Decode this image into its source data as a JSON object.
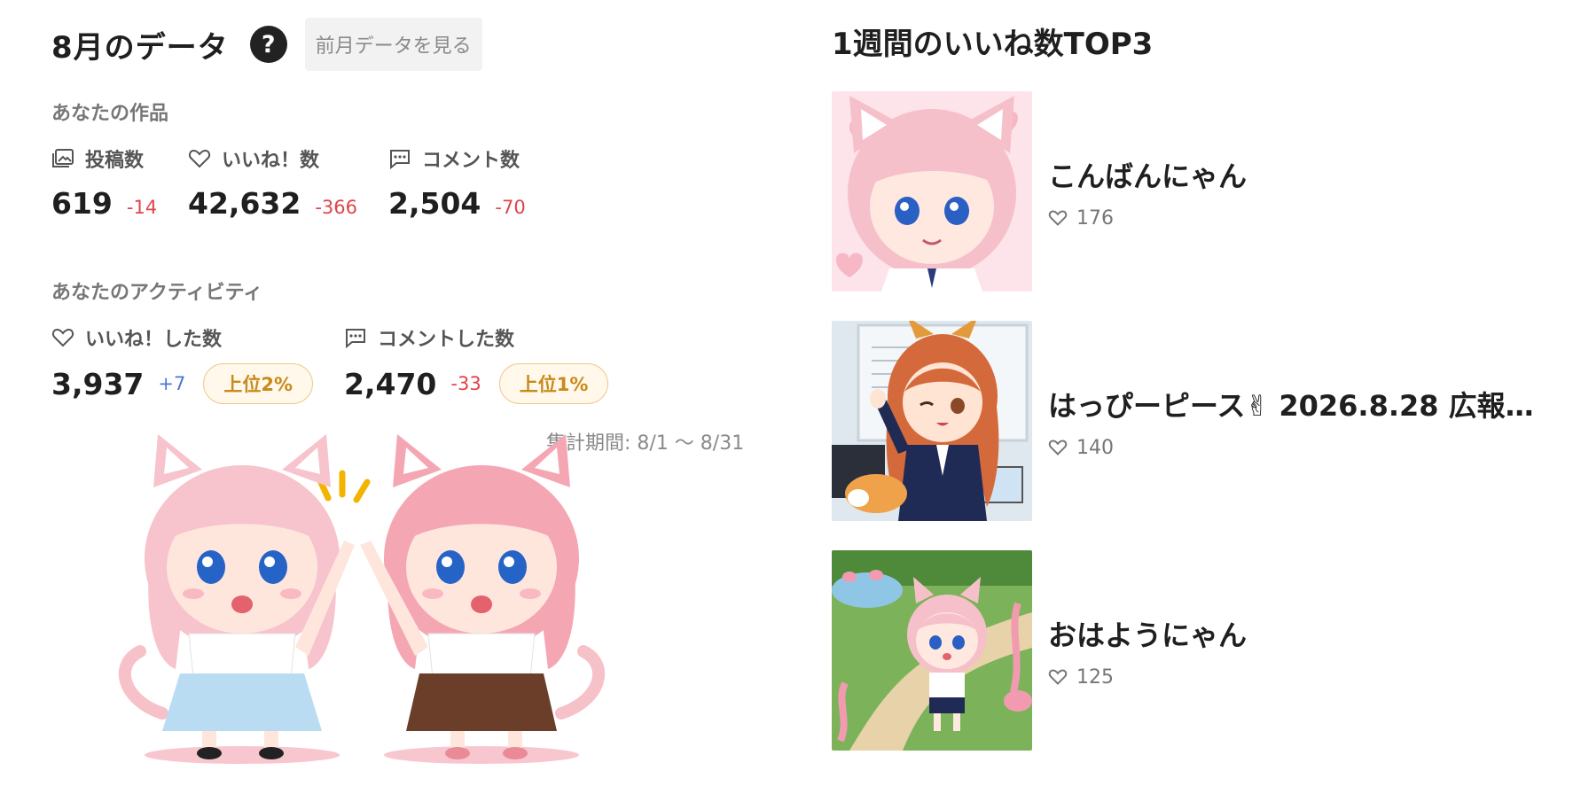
{
  "header": {
    "title": "8月のデータ",
    "help_icon": "?",
    "prev_button": "前月データを見る"
  },
  "works": {
    "section_label": "あなたの作品",
    "stats": [
      {
        "icon": "posts-icon",
        "label": "投稿数",
        "value": "619",
        "delta": "-14"
      },
      {
        "icon": "heart-icon",
        "label": "いいね！数",
        "value": "42,632",
        "delta": "-366"
      },
      {
        "icon": "comment-icon",
        "label": "コメント数",
        "value": "2,504",
        "delta": "-70"
      }
    ]
  },
  "activity": {
    "section_label": "あなたのアクティビティ",
    "stats": [
      {
        "icon": "heart-icon",
        "label": "いいね！した数",
        "value": "3,937",
        "delta": "+7",
        "rank": "上位2%"
      },
      {
        "icon": "comment-icon",
        "label": "コメントした数",
        "value": "2,470",
        "delta": "-33",
        "rank": "上位1%"
      }
    ],
    "period": "集計期間: 8/1 〜 8/31"
  },
  "top3": {
    "title": "1週間のいいね数TOP3",
    "items": [
      {
        "title": "こんばんにゃん",
        "likes": "176"
      },
      {
        "title": "はっぴーピース✌ 2026.8.28 広報…",
        "likes": "140"
      },
      {
        "title": "おはようにゃん",
        "likes": "125"
      }
    ]
  },
  "colors": {
    "negative": "#e0444a",
    "positive": "#4a78d8",
    "rank_badge": "#c98a1b"
  }
}
